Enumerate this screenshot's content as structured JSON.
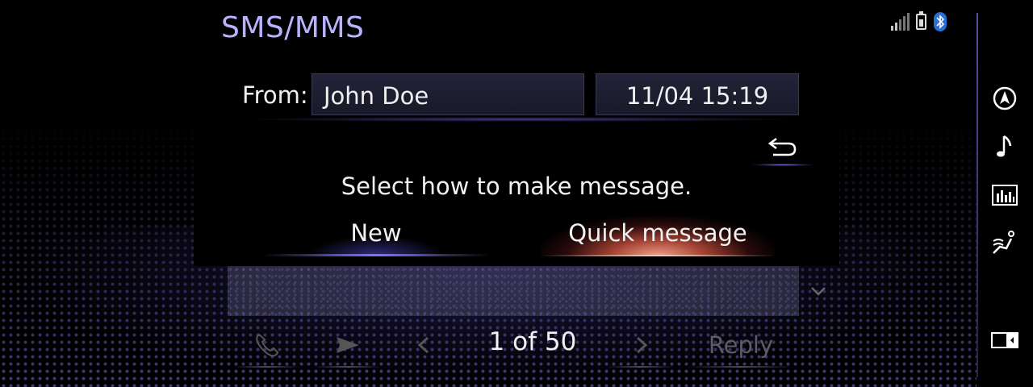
{
  "screen": {
    "title": "SMS/MMS"
  },
  "status_bar": {
    "icons": [
      "signal-strength-icon",
      "battery-icon",
      "bluetooth-icon"
    ]
  },
  "sidebar": {
    "items": [
      {
        "name": "navigation",
        "icon": "compass-icon"
      },
      {
        "name": "audio",
        "icon": "music-note-icon"
      },
      {
        "name": "info",
        "icon": "bar-graph-icon"
      },
      {
        "name": "climate",
        "icon": "seat-airflow-icon"
      },
      {
        "name": "display",
        "icon": "screen-toggle-icon"
      }
    ]
  },
  "message": {
    "from_label": "From:",
    "sender": "John Doe",
    "datetime": "11/04  15:19"
  },
  "dialog": {
    "prompt": "Select how to make message.",
    "back_icon": "return-arrow-icon",
    "options": [
      {
        "label": "New",
        "selected": false
      },
      {
        "label": "Quick message",
        "selected": true
      }
    ]
  },
  "toolbar": {
    "page_indicator": "1 of 50",
    "reply_label": "Reply",
    "icons": [
      "phone-icon",
      "send-icon",
      "chevron-left-icon",
      "chevron-right-icon"
    ]
  },
  "colors": {
    "title": "#b9b3ff",
    "accent_blue": "#8278ff",
    "selected_glow": "#dc5a46"
  }
}
